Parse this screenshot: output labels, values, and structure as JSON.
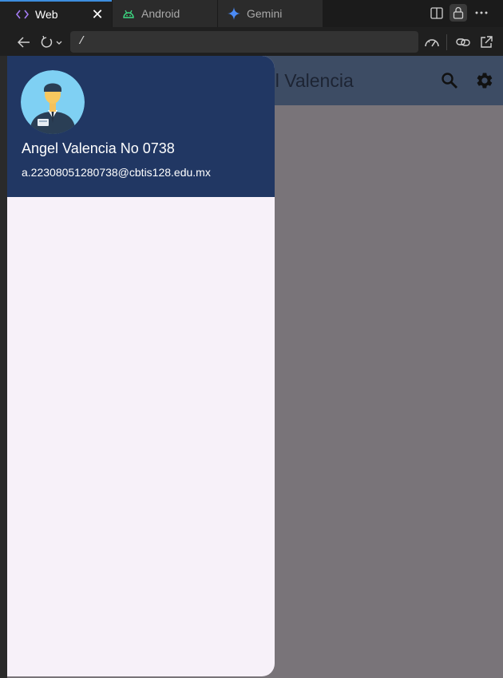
{
  "tabs": [
    {
      "label": "Web",
      "icon": "code-brackets-icon",
      "active": true
    },
    {
      "label": "Android",
      "icon": "android-icon",
      "active": false
    },
    {
      "label": "Gemini",
      "icon": "gemini-sparkle-icon",
      "active": false
    }
  ],
  "toolbar": {
    "url": "/"
  },
  "appbar": {
    "title": "Angel Valencia"
  },
  "drawer": {
    "user_name": "Angel Valencia No 0738",
    "user_email": "a.22308051280738@cbtis128.edu.mx"
  },
  "colors": {
    "drawer_header": "#213763",
    "drawer_body": "#f7f1f9",
    "appbar": "#3d4c64",
    "scrim": "#797479",
    "accent_tab": "#3c8dde"
  }
}
